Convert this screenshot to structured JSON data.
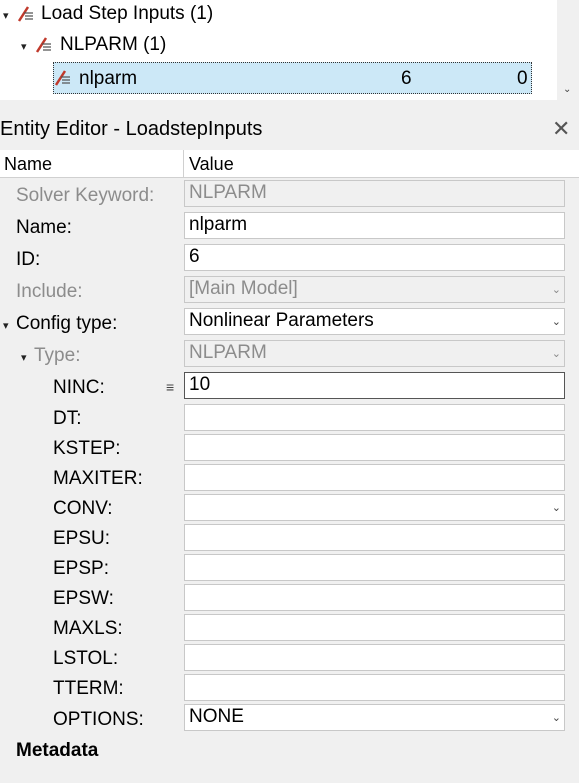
{
  "tree": {
    "root": {
      "label": "Load Step Inputs",
      "count": "(1)"
    },
    "child": {
      "label": "NLPARM",
      "count": "(1)"
    },
    "item": {
      "label": "nlparm",
      "id": "6",
      "col2": "0"
    }
  },
  "editor": {
    "title": "Entity Editor - LoadstepInputs",
    "headers": {
      "name": "Name",
      "value": "Value"
    },
    "rows": {
      "solver_keyword": {
        "label": "Solver Keyword:",
        "value": "NLPARM"
      },
      "name": {
        "label": "Name:",
        "value": "nlparm"
      },
      "id": {
        "label": "ID:",
        "value": "6"
      },
      "include": {
        "label": "Include:",
        "value": "[Main Model]"
      },
      "config_type": {
        "label": "Config type:",
        "value": "Nonlinear Parameters"
      },
      "type": {
        "label": "Type:",
        "value": "NLPARM"
      },
      "ninc": {
        "label": "NINC:",
        "value": "10"
      },
      "dt": {
        "label": "DT:",
        "value": ""
      },
      "kstep": {
        "label": "KSTEP:",
        "value": ""
      },
      "maxiter": {
        "label": "MAXITER:",
        "value": ""
      },
      "conv": {
        "label": "CONV:",
        "value": ""
      },
      "epsu": {
        "label": "EPSU:",
        "value": ""
      },
      "epsp": {
        "label": "EPSP:",
        "value": ""
      },
      "epsw": {
        "label": "EPSW:",
        "value": ""
      },
      "maxls": {
        "label": "MAXLS:",
        "value": ""
      },
      "lstol": {
        "label": "LSTOL:",
        "value": ""
      },
      "tterm": {
        "label": "TTERM:",
        "value": ""
      },
      "options": {
        "label": "OPTIONS:",
        "value": "NONE"
      }
    },
    "metadata_label": "Metadata"
  },
  "icons": {
    "loadstep": "loadstep-icon",
    "close": "close-icon",
    "dropdown": "chevron-down-icon",
    "expand": "collapse-caret-icon",
    "menu": "menu-lines-icon"
  },
  "colors": {
    "selection": "#cce8f7",
    "disabled_text": "#8c8c8c",
    "icon_red": "#c0392b"
  }
}
